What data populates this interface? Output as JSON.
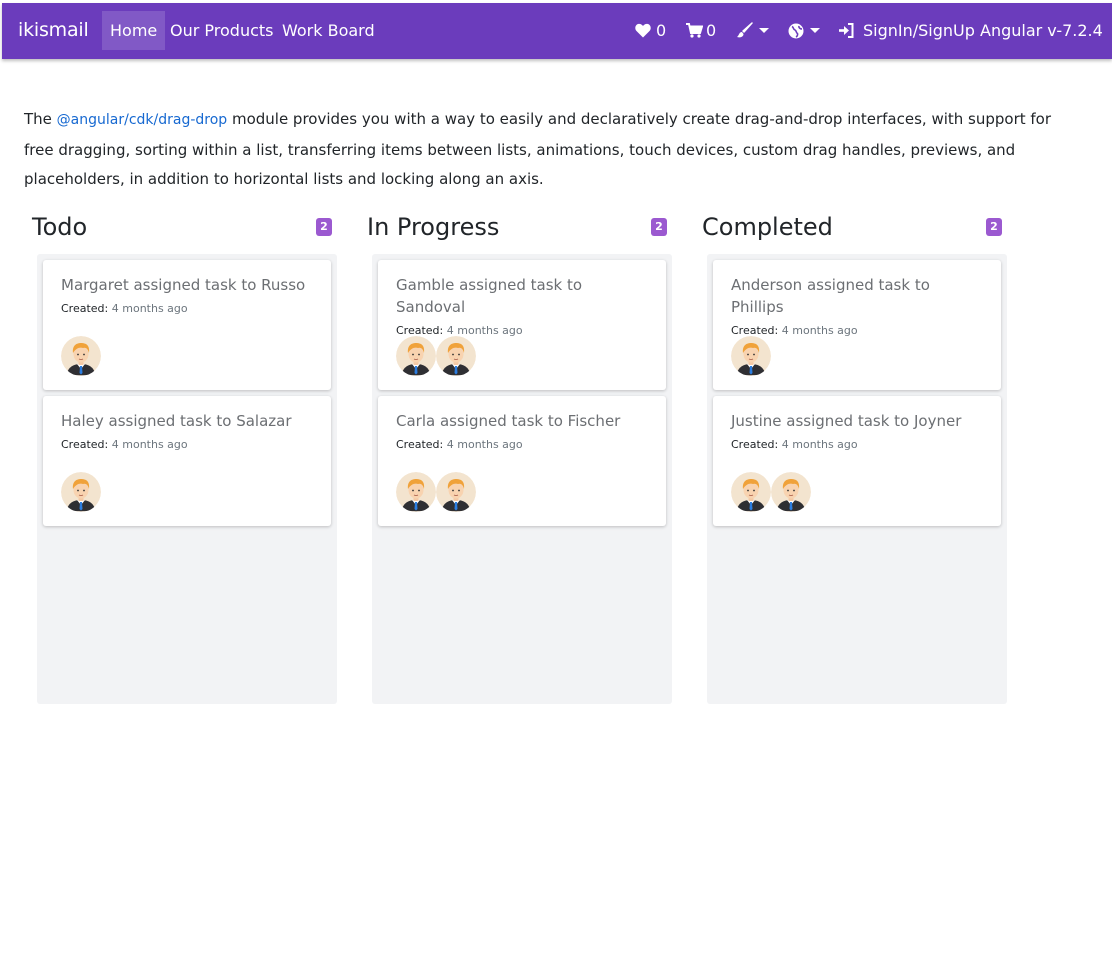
{
  "navbar": {
    "brand": "ikismail",
    "links": [
      {
        "label": "Home",
        "active": true
      },
      {
        "label": "Our Products",
        "active": false
      },
      {
        "label": "Work Board",
        "active": false
      }
    ],
    "favorites_count": "0",
    "cart_count": "0",
    "signin_label": "SignIn/SignUp",
    "version_label": "Angular v-7.2.4",
    "icons": [
      "heart-icon",
      "cart-icon",
      "brush-icon",
      "globe-icon",
      "sign-in-icon"
    ],
    "colors": {
      "navbar_bg": "#6b3cbc"
    }
  },
  "intro": {
    "prefix": "The ",
    "link_text": "@angular/cdk/drag-drop",
    "suffix": " module provides you with a way to easily and declaratively create drag-and-drop interfaces, with support for free dragging, sorting within a list, transferring items between lists, animations, touch devices, custom drag handles, previews, and placeholders, in addition to horizontal lists and locking along an axis."
  },
  "board": {
    "created_label": "Created:",
    "colors": {
      "badge": "#9b59d0",
      "column_bg": "#f2f3f5"
    },
    "columns": [
      {
        "title": "Todo",
        "count": "2",
        "cards": [
          {
            "title": "Margaret assigned task to Russo",
            "ago": "4 months ago",
            "avatars": 1
          },
          {
            "title": "Haley assigned task to Salazar",
            "ago": "4 months ago",
            "avatars": 1
          }
        ]
      },
      {
        "title": "In Progress",
        "count": "2",
        "cards": [
          {
            "title": "Gamble assigned task to Sandoval",
            "ago": "4 months ago",
            "avatars": 2
          },
          {
            "title": "Carla assigned task to Fischer",
            "ago": "4 months ago",
            "avatars": 2
          }
        ]
      },
      {
        "title": "Completed",
        "count": "2",
        "cards": [
          {
            "title": "Anderson assigned task to Phillips",
            "ago": "4 months ago",
            "avatars": 1
          },
          {
            "title": "Justine assigned task to Joyner",
            "ago": "4 months ago",
            "avatars": 2
          }
        ]
      }
    ]
  }
}
